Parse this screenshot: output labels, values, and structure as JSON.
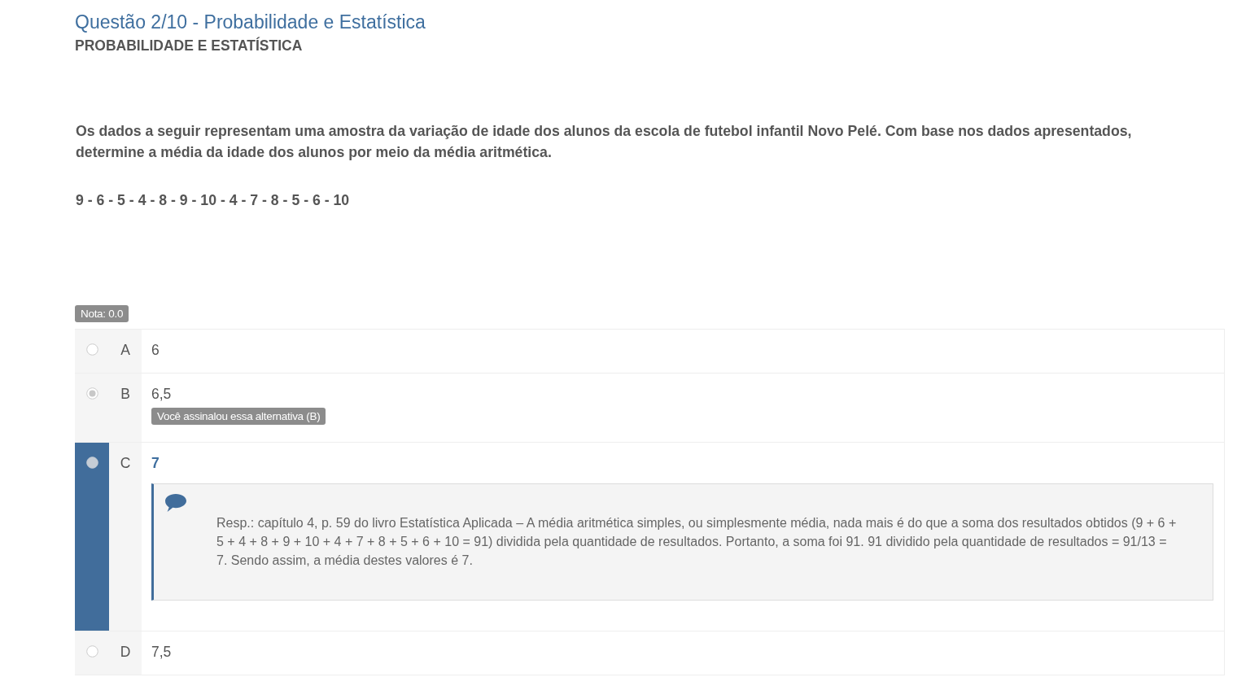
{
  "header": {
    "title": "Questão 2/10 - Probabilidade e Estatística",
    "subject": "PROBABILIDADE E ESTATÍSTICA"
  },
  "question": {
    "statement": "Os dados a seguir representam uma amostra da variação de idade dos alunos da escola de futebol infantil Novo Pelé. Com base nos dados apresentados, determine a média da idade dos alunos por meio da média aritmética.",
    "data": "9 - 6 - 5 - 4 - 8 - 9 - 10 - 4 - 7 - 8 - 5 - 6 - 10"
  },
  "grade": "Nota: 0.0",
  "options": [
    {
      "letter": "A",
      "text": "6",
      "selected": false,
      "correct": false
    },
    {
      "letter": "B",
      "text": "6,5",
      "selected": true,
      "correct": false,
      "badge": "Você assinalou essa alternativa (B)"
    },
    {
      "letter": "C",
      "text": "7",
      "selected": false,
      "correct": true,
      "feedback": "Resp.: capítulo 4, p. 59 do livro Estatística Aplicada – A média aritmética simples, ou simplesmente média, nada mais é do que a soma dos resultados obtidos (9 + 6 + 5 + 4 + 8 + 9 + 10 + 4 + 7 + 8 + 5 + 6 + 10 = 91) dividida pela quantidade de resultados. Portanto, a soma foi 91. 91 dividido pela quantidade de resultados = 91/13 = 7. Sendo assim, a média destes valores é 7."
    },
    {
      "letter": "D",
      "text": "7,5",
      "selected": false,
      "correct": false
    }
  ]
}
